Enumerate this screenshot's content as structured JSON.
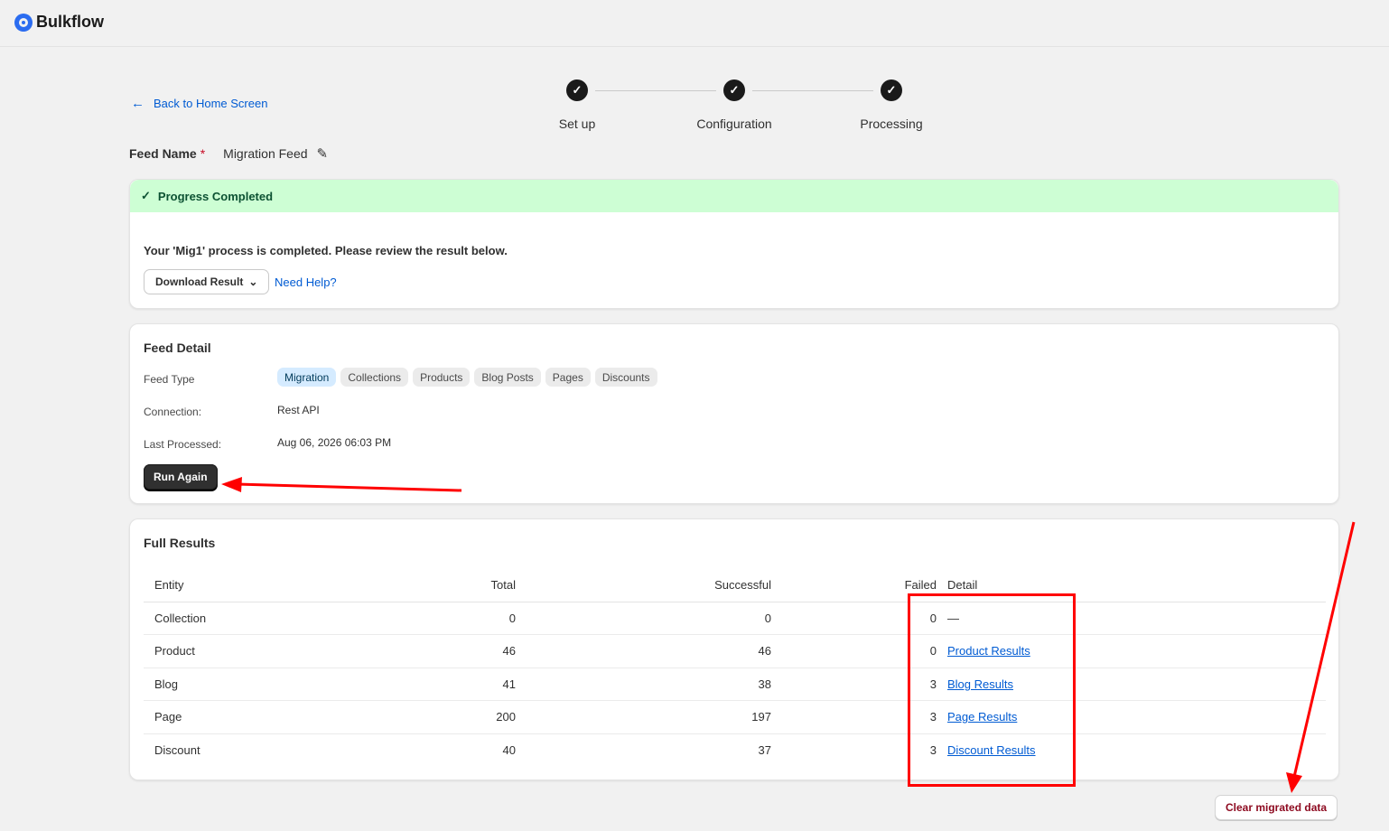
{
  "app": {
    "name": "Bulkflow"
  },
  "back_link": "Back to Home Screen",
  "stepper": {
    "steps": [
      {
        "label": "Set up",
        "icon": "check-icon"
      },
      {
        "label": "Configuration",
        "icon": "check-icon"
      },
      {
        "label": "Processing",
        "icon": "check-icon"
      }
    ]
  },
  "feed_name": {
    "label": "Feed Name",
    "required_mark": "*",
    "value": "Migration Feed"
  },
  "status_card": {
    "banner": "Progress Completed",
    "message": "Your 'Mig1' process is completed. Please review the result below.",
    "download_label": "Download Result",
    "help_label": "Need Help?"
  },
  "feed_detail": {
    "title": "Feed Detail",
    "feed_type_label": "Feed Type",
    "tags": [
      "Migration",
      "Collections",
      "Products",
      "Blog Posts",
      "Pages",
      "Discounts"
    ],
    "active_tag": "Migration",
    "connection_label": "Connection:",
    "connection_value": "Rest API",
    "last_processed_label": "Last Processed:",
    "last_processed_value": "Aug 06, 2026 06:03 PM",
    "run_again_label": "Run Again"
  },
  "full_results": {
    "title": "Full Results",
    "headers": [
      "Entity",
      "Total",
      "Successful",
      "Failed",
      "Detail"
    ],
    "rows": [
      {
        "entity": "Collection",
        "total": "0",
        "successful": "0",
        "failed": "0",
        "detail": "—",
        "is_link": false
      },
      {
        "entity": "Product",
        "total": "46",
        "successful": "46",
        "failed": "0",
        "detail": "Product Results",
        "is_link": true
      },
      {
        "entity": "Blog",
        "total": "41",
        "successful": "38",
        "failed": "3",
        "detail": "Blog Results",
        "is_link": true
      },
      {
        "entity": "Page",
        "total": "200",
        "successful": "197",
        "failed": "3",
        "detail": "Page Results",
        "is_link": true
      },
      {
        "entity": "Discount",
        "total": "40",
        "successful": "37",
        "failed": "3",
        "detail": "Discount Results",
        "is_link": true
      }
    ]
  },
  "clear_button": "Clear migrated data",
  "colors": {
    "accent": "#005bd3",
    "success_bg": "#cdfed4",
    "annotation": "#ff0000",
    "critical_text": "#8e0b21"
  }
}
